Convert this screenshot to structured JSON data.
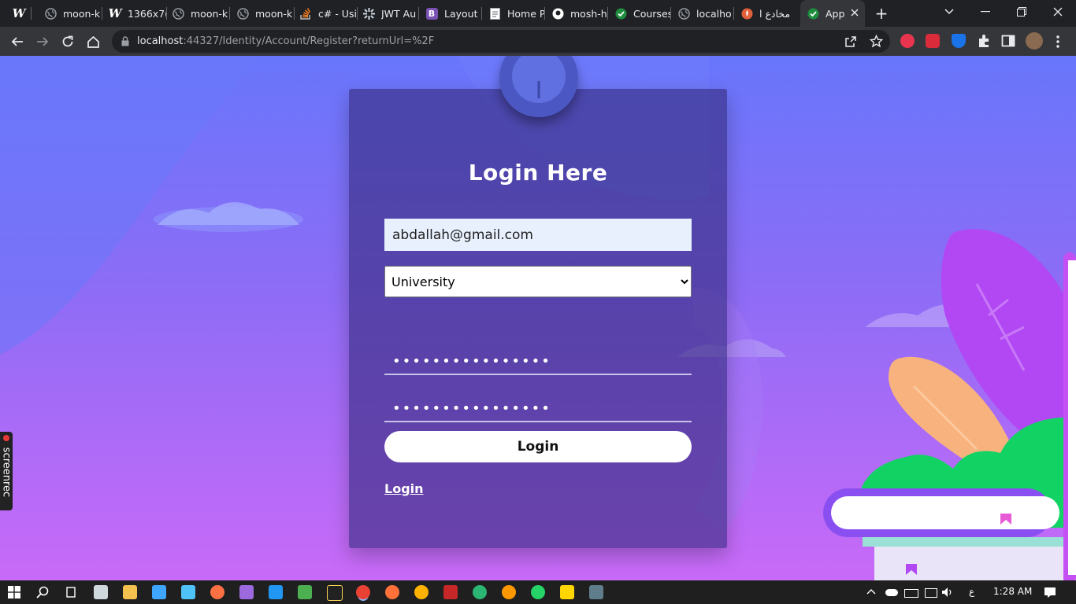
{
  "browser": {
    "tabs": [
      {
        "label": "",
        "icon": "wordpress-icon",
        "color": "#ffffff"
      },
      {
        "label": "moon-k",
        "icon": "globe-icon",
        "color": "#9aa0a6"
      },
      {
        "label": "1366x7(",
        "icon": "wordpress-icon",
        "color": "#ffffff"
      },
      {
        "label": "moon-k",
        "icon": "globe-icon",
        "color": "#9aa0a6"
      },
      {
        "label": "moon-k",
        "icon": "globe-icon",
        "color": "#9aa0a6"
      },
      {
        "label": "c# - Usi",
        "icon": "stackoverflow-icon",
        "color": "#f48024"
      },
      {
        "label": "JWT Au",
        "icon": "jwt-icon",
        "color": "#cfd8e3"
      },
      {
        "label": "Layout",
        "icon": "bootstrap-icon",
        "color": "#7952b3"
      },
      {
        "label": "Home P",
        "icon": "document-icon",
        "color": "#e8eaed"
      },
      {
        "label": "mosh-h",
        "icon": "github-icon",
        "color": "#ffffff"
      },
      {
        "label": "Courses",
        "icon": "check-circle-icon",
        "color": "#1e8e3e"
      },
      {
        "label": "localho",
        "icon": "globe-icon",
        "color": "#9aa0a6"
      },
      {
        "label": "مخادع ا",
        "icon": "flame-icon",
        "color": "#e0603a"
      },
      {
        "label": "App",
        "icon": "check-circle-icon",
        "color": "#1e8e3e",
        "active": true
      }
    ],
    "url_host": "localhost",
    "url_rest": ":44327/Identity/Account/Register?returnUrl=%2F"
  },
  "page": {
    "card_title": "Login Here",
    "email_value": "abdallah@gmail.com",
    "type_select": {
      "selected": "University"
    },
    "password_mask": "••••••••••••••••",
    "confirm_password_mask": "••••••••••••••••",
    "login_button_label": "Login",
    "login_link_label": "Login"
  },
  "overlay": {
    "screenrec_label": "screenrec"
  },
  "taskbar": {
    "time": "1:28 AM",
    "ime": "ع"
  },
  "colors": {
    "page_top": "#6876fb",
    "page_bottom": "#c96af8",
    "card": "#342a7d",
    "accent_avatar": "#4b58c4"
  }
}
